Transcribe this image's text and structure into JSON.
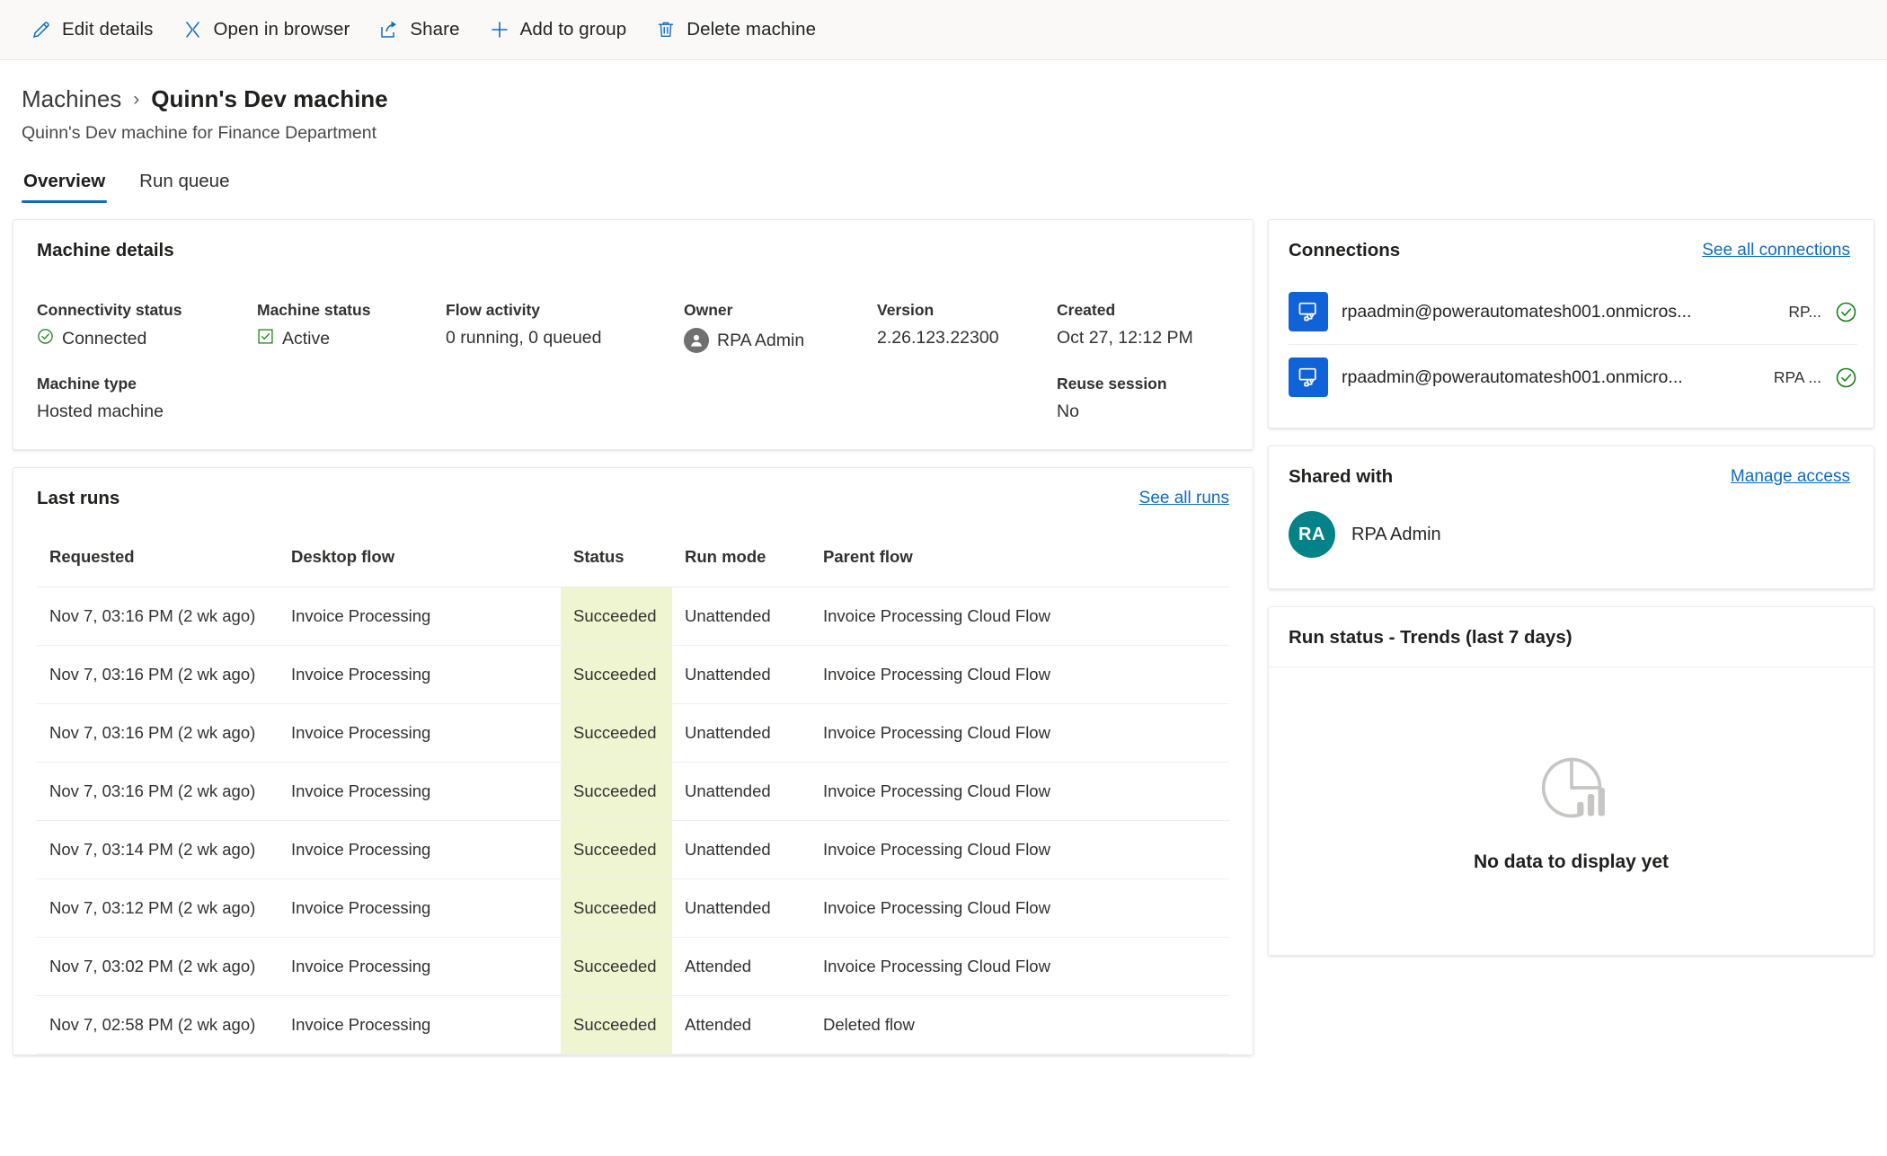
{
  "toolbar": {
    "items": [
      {
        "label": "Edit details",
        "icon": "pencil-icon"
      },
      {
        "label": "Open in browser",
        "icon": "open-in-browser-icon"
      },
      {
        "label": "Share",
        "icon": "share-icon"
      },
      {
        "label": "Add to group",
        "icon": "plus-icon"
      },
      {
        "label": "Delete machine",
        "icon": "trash-icon"
      }
    ]
  },
  "header": {
    "breadcrumb_parent": "Machines",
    "breadcrumb_separator": "›",
    "title": "Quinn's Dev machine",
    "subtitle": "Quinn's Dev machine for Finance Department"
  },
  "tabs": [
    {
      "label": "Overview",
      "active": true
    },
    {
      "label": "Run queue",
      "active": false
    }
  ],
  "machine_details": {
    "title": "Machine details",
    "connectivity_status": {
      "label": "Connectivity status",
      "value": "Connected"
    },
    "machine_status": {
      "label": "Machine status",
      "value": "Active"
    },
    "flow_activity": {
      "label": "Flow activity",
      "value": "0 running, 0 queued"
    },
    "owner": {
      "label": "Owner",
      "value": "RPA Admin"
    },
    "version": {
      "label": "Version",
      "value": "2.26.123.22300"
    },
    "created": {
      "label": "Created",
      "value": "Oct 27, 12:12 PM"
    },
    "machine_type": {
      "label": "Machine type",
      "value": "Hosted machine"
    },
    "reuse_session": {
      "label": "Reuse session",
      "value": "No"
    }
  },
  "last_runs": {
    "title": "Last runs",
    "see_all_label": "See all runs",
    "columns": [
      "Requested",
      "Desktop flow",
      "Status",
      "Run mode",
      "Parent flow"
    ],
    "rows": [
      {
        "requested": "Nov 7, 03:16 PM (2 wk ago)",
        "desktop_flow": "Invoice Processing",
        "status": "Succeeded",
        "run_mode": "Unattended",
        "parent_flow": "Invoice Processing Cloud Flow",
        "parent_deleted": false
      },
      {
        "requested": "Nov 7, 03:16 PM (2 wk ago)",
        "desktop_flow": "Invoice Processing",
        "status": "Succeeded",
        "run_mode": "Unattended",
        "parent_flow": "Invoice Processing Cloud Flow",
        "parent_deleted": false
      },
      {
        "requested": "Nov 7, 03:16 PM (2 wk ago)",
        "desktop_flow": "Invoice Processing",
        "status": "Succeeded",
        "run_mode": "Unattended",
        "parent_flow": "Invoice Processing Cloud Flow",
        "parent_deleted": false
      },
      {
        "requested": "Nov 7, 03:16 PM (2 wk ago)",
        "desktop_flow": "Invoice Processing",
        "status": "Succeeded",
        "run_mode": "Unattended",
        "parent_flow": "Invoice Processing Cloud Flow",
        "parent_deleted": false
      },
      {
        "requested": "Nov 7, 03:14 PM (2 wk ago)",
        "desktop_flow": "Invoice Processing",
        "status": "Succeeded",
        "run_mode": "Unattended",
        "parent_flow": "Invoice Processing Cloud Flow",
        "parent_deleted": false
      },
      {
        "requested": "Nov 7, 03:12 PM (2 wk ago)",
        "desktop_flow": "Invoice Processing",
        "status": "Succeeded",
        "run_mode": "Unattended",
        "parent_flow": "Invoice Processing Cloud Flow",
        "parent_deleted": false
      },
      {
        "requested": "Nov 7, 03:02 PM (2 wk ago)",
        "desktop_flow": "Invoice Processing",
        "status": "Succeeded",
        "run_mode": "Attended",
        "parent_flow": "Invoice Processing Cloud Flow",
        "parent_deleted": false
      },
      {
        "requested": "Nov 7, 02:58 PM (2 wk ago)",
        "desktop_flow": "Invoice Processing",
        "status": "Succeeded",
        "run_mode": "Attended",
        "parent_flow": "Deleted flow",
        "parent_deleted": true
      }
    ]
  },
  "connections": {
    "title": "Connections",
    "see_all_label": "See all connections",
    "items": [
      {
        "name": "rpaadmin@powerautomatesh001.onmicros...",
        "sub": "RP...",
        "status": "connected"
      },
      {
        "name": "rpaadmin@powerautomatesh001.onmicro...",
        "sub": "RPA ...",
        "status": "connected"
      }
    ]
  },
  "shared_with": {
    "title": "Shared with",
    "manage_label": "Manage access",
    "users": [
      {
        "initials": "RA",
        "name": "RPA Admin"
      }
    ]
  },
  "run_status_trends": {
    "title": "Run status - Trends (last 7 days)",
    "empty_message": "No data to display yet"
  },
  "colors": {
    "accent": "#0f6cbd",
    "success_green": "#107c10",
    "status_cell_bg": "#eef5d0",
    "connection_icon_bg": "#0f62d8",
    "avatar_teal": "#038387"
  }
}
